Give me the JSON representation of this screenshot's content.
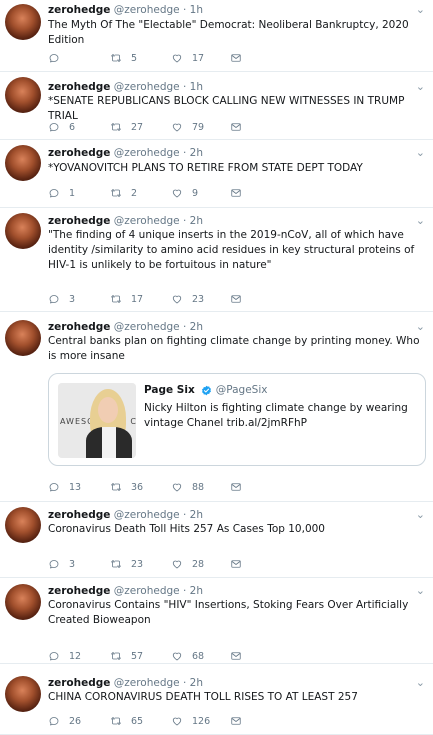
{
  "tweets": [
    {
      "name": "zerohedge",
      "handle": "@zerohedge",
      "time": "1h",
      "text": "The Myth Of The \"Electable\" Democrat: Neoliberal Bankruptcy, 2020 Edition",
      "reply_count": "",
      "retweet_count": "5",
      "like_count": "17"
    },
    {
      "name": "zerohedge",
      "handle": "@zerohedge",
      "time": "1h",
      "text": "*SENATE REPUBLICANS BLOCK CALLING NEW WITNESSES IN TRUMP TRIAL",
      "reply_count": "6",
      "retweet_count": "27",
      "like_count": "79"
    },
    {
      "name": "zerohedge",
      "handle": "@zerohedge",
      "time": "2h",
      "text": "*YOVANOVITCH PLANS TO RETIRE FROM STATE DEPT TODAY",
      "reply_count": "1",
      "retweet_count": "2",
      "like_count": "9"
    },
    {
      "name": "zerohedge",
      "handle": "@zerohedge",
      "time": "2h",
      "text": "\"The finding of 4 unique inserts in the 2019-nCoV, all of which have identity /similarity to amino acid residues in key structural proteins of HIV-1 is unlikely to be fortuitous in nature\"",
      "reply_count": "3",
      "retweet_count": "17",
      "like_count": "23"
    },
    {
      "name": "zerohedge",
      "handle": "@zerohedge",
      "time": "2h",
      "text": "Central banks plan on fighting climate change by printing money.  Who is more insane",
      "reply_count": "13",
      "retweet_count": "36",
      "like_count": "88",
      "quote": {
        "name": "Page Six",
        "handle": "@PageSix",
        "text": "Nicky Hilton is fighting climate change by wearing vintage Chanel trib.al/2jmRFhP",
        "image_word": "AWESOME",
        "image_mark": "C"
      }
    },
    {
      "name": "zerohedge",
      "handle": "@zerohedge",
      "time": "2h",
      "text": "Coronavirus Death Toll Hits 257 As Cases Top 10,000",
      "reply_count": "3",
      "retweet_count": "23",
      "like_count": "28"
    },
    {
      "name": "zerohedge",
      "handle": "@zerohedge",
      "time": "2h",
      "text": "Coronavirus Contains \"HIV\" Insertions, Stoking Fears Over Artificially Created Bioweapon",
      "reply_count": "12",
      "retweet_count": "57",
      "like_count": "68"
    },
    {
      "name": "zerohedge",
      "handle": "@zerohedge",
      "time": "2h",
      "text": "CHINA CORONAVIRUS DEATH TOLL RISES TO AT LEAST 257",
      "reply_count": "26",
      "retweet_count": "65",
      "like_count": "126"
    }
  ],
  "separator": "·",
  "menu_glyph": "⌄",
  "icons": {
    "reply": "reply-icon",
    "retweet": "retweet-icon",
    "like": "heart-icon",
    "share": "mail-icon",
    "verified": "verified-badge-icon",
    "menu": "chevron-down-icon"
  },
  "colors": {
    "text": "#14171a",
    "muted": "#657786",
    "border": "#e6ecf0",
    "verified": "#1da1f2"
  }
}
